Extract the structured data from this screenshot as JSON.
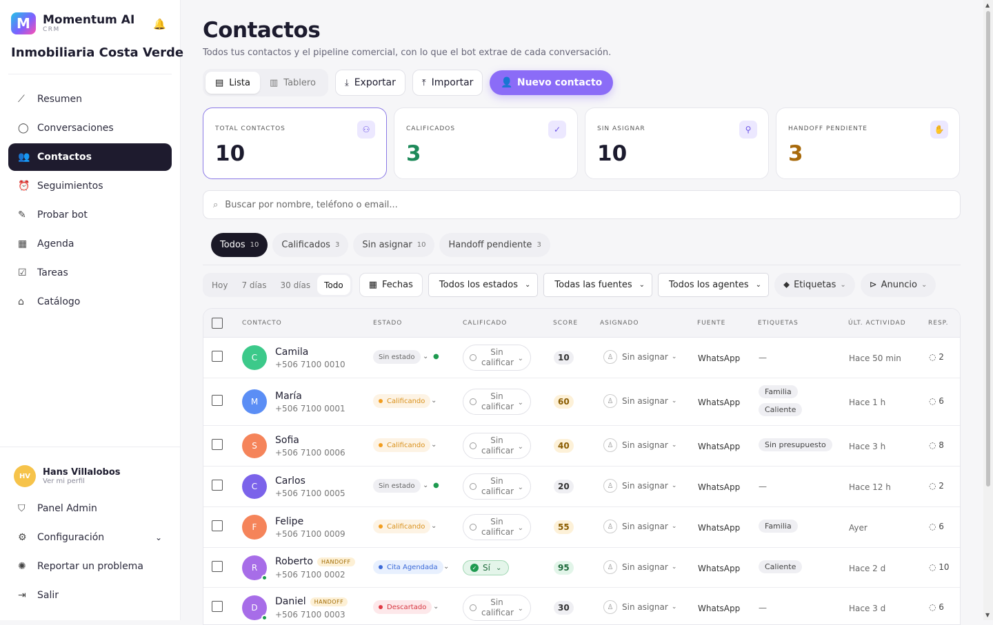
{
  "brand": {
    "name": "Momentum AI",
    "sub": "CRM",
    "logo_letter": "M",
    "org": "Inmobiliaria Costa Verde"
  },
  "nav": [
    {
      "label": "Resumen",
      "icon": "chart-line-icon"
    },
    {
      "label": "Conversaciones",
      "icon": "chat-bubble-icon"
    },
    {
      "label": "Contactos",
      "icon": "users-icon",
      "active": true
    },
    {
      "label": "Seguimientos",
      "icon": "alarm-bell-icon"
    },
    {
      "label": "Probar bot",
      "icon": "pencil-icon"
    },
    {
      "label": "Agenda",
      "icon": "calendar-icon"
    },
    {
      "label": "Tareas",
      "icon": "checkbox-icon"
    },
    {
      "label": "Catálogo",
      "icon": "store-icon"
    }
  ],
  "user": {
    "initials": "HV",
    "name": "Hans Villalobos",
    "link": "Ver mi perfil"
  },
  "bottom_nav": {
    "admin": "Panel Admin",
    "config": "Configuración",
    "report": "Reportar un problema",
    "logout": "Salir"
  },
  "page": {
    "title": "Contactos",
    "subtitle": "Todos tus contactos y el pipeline comercial, con lo que el bot extrae de cada conversación."
  },
  "toolbar": {
    "view_list": "Lista",
    "view_board": "Tablero",
    "export": "Exportar",
    "import": "Importar",
    "new_contact": "Nuevo contacto"
  },
  "stats": [
    {
      "label": "TOTAL CONTACTOS",
      "value": "10",
      "color": "#1c1b2e"
    },
    {
      "label": "CALIFICADOS",
      "value": "3",
      "color": "#1e8a5a"
    },
    {
      "label": "SIN ASIGNAR",
      "value": "10",
      "color": "#1c1b2e"
    },
    {
      "label": "HANDOFF PENDIENTE",
      "value": "3",
      "color": "#a86a0c"
    }
  ],
  "search": {
    "placeholder": "Buscar por nombre, teléfono o email..."
  },
  "tabs": [
    {
      "label": "Todos",
      "count": "10"
    },
    {
      "label": "Calificados",
      "count": "3"
    },
    {
      "label": "Sin asignar",
      "count": "10"
    },
    {
      "label": "Handoff pendiente",
      "count": "3"
    }
  ],
  "filters": {
    "ranges": [
      "Hoy",
      "7 días",
      "30 días",
      "Todo"
    ],
    "dates": "Fechas",
    "status": "Todos los estados",
    "sources": "Todas las fuentes",
    "agents": "Todos los agentes",
    "tags": "Etiquetas",
    "ad": "Anuncio"
  },
  "table": {
    "headers": {
      "contact": "CONTACTO",
      "status": "ESTADO",
      "qualified": "CALIFICADO",
      "score": "SCORE",
      "assigned": "ASIGNADO",
      "source": "FUENTE",
      "tags": "ETIQUETAS",
      "activity": "ÚLT. ACTIVIDAD",
      "resp": "RESP."
    },
    "rows": [
      {
        "initial": "C",
        "name": "Camila",
        "phone": "+506 7100 0010",
        "status": "Sin estado",
        "status_kind": "none",
        "qualified": "Sin calificar",
        "score": "10",
        "score_kind": "g",
        "assigned": "Sin asignar",
        "source": "WhatsApp",
        "tags": [],
        "empty_tag": "—",
        "activity": "Hace 50 min",
        "resp": "2",
        "av_color": "#3cc98a",
        "handoff": ""
      },
      {
        "initial": "M",
        "name": "María",
        "phone": "+506 7100 0001",
        "status": "Calificando",
        "status_kind": "cal",
        "qualified": "Sin calificar",
        "score": "60",
        "score_kind": "y",
        "assigned": "Sin asignar",
        "source": "WhatsApp",
        "tags": [
          "Familia",
          "Caliente"
        ],
        "activity": "Hace 1 h",
        "resp": "6",
        "av_color": "#5b8ef5",
        "handoff": ""
      },
      {
        "initial": "S",
        "name": "Sofia",
        "phone": "+506 7100 0006",
        "status": "Calificando",
        "status_kind": "cal",
        "qualified": "Sin calificar",
        "score": "40",
        "score_kind": "y",
        "assigned": "Sin asignar",
        "source": "WhatsApp",
        "tags": [
          "Sin presupuesto"
        ],
        "activity": "Hace 3 h",
        "resp": "8",
        "av_color": "#f5845a",
        "handoff": ""
      },
      {
        "initial": "C",
        "name": "Carlos",
        "phone": "+506 7100 0005",
        "status": "Sin estado",
        "status_kind": "none",
        "qualified": "Sin calificar",
        "score": "20",
        "score_kind": "g",
        "assigned": "Sin asignar",
        "source": "WhatsApp",
        "tags": [],
        "empty_tag": "—",
        "activity": "Hace 12 h",
        "resp": "2",
        "av_color": "#7b63ea",
        "handoff": ""
      },
      {
        "initial": "F",
        "name": "Felipe",
        "phone": "+506 7100 0009",
        "status": "Calificando",
        "status_kind": "cal",
        "qualified": "Sin calificar",
        "score": "55",
        "score_kind": "y",
        "assigned": "Sin asignar",
        "source": "WhatsApp",
        "tags": [
          "Familia"
        ],
        "activity": "Ayer",
        "resp": "6",
        "av_color": "#f5845a",
        "handoff": ""
      },
      {
        "initial": "R",
        "name": "Roberto",
        "phone": "+506 7100 0002",
        "status": "Cita Agendada",
        "status_kind": "cita",
        "qualified": "Sí",
        "score": "95",
        "score_kind": "gr",
        "assigned": "Sin asignar",
        "source": "WhatsApp",
        "tags": [
          "Caliente"
        ],
        "activity": "Hace 2 d",
        "resp": "10",
        "av_color": "#a76de8",
        "handoff": "HANDOFF"
      },
      {
        "initial": "D",
        "name": "Daniel",
        "phone": "+506 7100 0003",
        "status": "Descartado",
        "status_kind": "desc",
        "qualified": "Sin calificar",
        "score": "30",
        "score_kind": "g",
        "assigned": "Sin asignar",
        "source": "WhatsApp",
        "tags": [],
        "empty_tag": "—",
        "activity": "Hace 3 d",
        "resp": "6",
        "av_color": "#a76de8",
        "handoff": "HANDOFF"
      }
    ]
  }
}
